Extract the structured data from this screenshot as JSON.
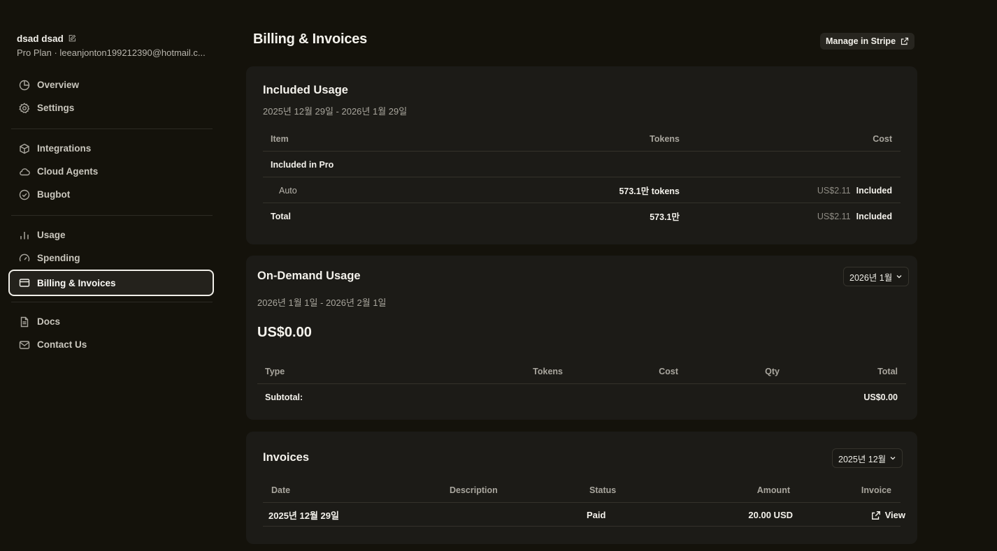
{
  "user": {
    "name": "dsad dsad",
    "subtitle": "Pro Plan · leeanjonton199212390@hotmail.c..."
  },
  "sidebar": {
    "group1": [
      {
        "label": "Overview",
        "icon": "pie-chart-icon"
      },
      {
        "label": "Settings",
        "icon": "gear-icon"
      }
    ],
    "group2": [
      {
        "label": "Integrations",
        "icon": "cube-icon"
      },
      {
        "label": "Cloud Agents",
        "icon": "cloud-icon"
      },
      {
        "label": "Bugbot",
        "icon": "check-circle-icon"
      }
    ],
    "group3": [
      {
        "label": "Usage",
        "icon": "bar-chart-icon"
      },
      {
        "label": "Spending",
        "icon": "gauge-icon"
      },
      {
        "label": "Billing & Invoices",
        "icon": "credit-card-icon",
        "active": true
      }
    ],
    "group4": [
      {
        "label": "Docs",
        "icon": "document-icon"
      },
      {
        "label": "Contact Us",
        "icon": "mail-icon"
      }
    ]
  },
  "header": {
    "title": "Billing & Invoices",
    "manage_label": "Manage in Stripe"
  },
  "included_usage": {
    "title": "Included Usage",
    "range": "2025년 12월 29일 - 2026년 1월 29일",
    "columns": {
      "item": "Item",
      "tokens": "Tokens",
      "cost": "Cost"
    },
    "section_label": "Included in Pro",
    "rows": [
      {
        "item": "Auto",
        "tokens": "573.1만 tokens",
        "cost": "US$2.11",
        "status": "Included"
      }
    ],
    "total": {
      "label": "Total",
      "tokens": "573.1만",
      "cost": "US$2.11",
      "status": "Included"
    }
  },
  "on_demand": {
    "title": "On-Demand Usage",
    "month_select": "2026년 1월",
    "range": "2026년 1월 1일 - 2026년 2월 1일",
    "amount": "US$0.00",
    "columns": {
      "type": "Type",
      "tokens": "Tokens",
      "cost": "Cost",
      "qty": "Qty",
      "total": "Total"
    },
    "subtotal_label": "Subtotal:",
    "subtotal_value": "US$0.00"
  },
  "invoices": {
    "title": "Invoices",
    "month_select": "2025년 12월",
    "columns": {
      "date": "Date",
      "description": "Description",
      "status": "Status",
      "amount": "Amount",
      "invoice": "Invoice"
    },
    "rows": [
      {
        "date": "2025년 12월 29일",
        "description": "",
        "status": "Paid",
        "amount": "20.00 USD",
        "invoice": "View"
      }
    ]
  }
}
